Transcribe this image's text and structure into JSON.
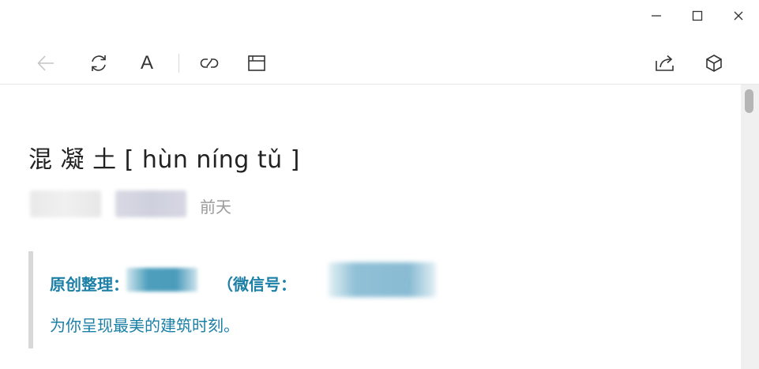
{
  "window": {
    "minimize": "minimize-icon",
    "maximize": "maximize-icon",
    "close": "close-icon"
  },
  "toolbar": {
    "left": [
      "back-arrow-icon",
      "refresh-icon",
      "text-size-icon",
      "link-icon",
      "window-icon"
    ],
    "right": [
      "share-icon",
      "cube-icon"
    ],
    "text_size_glyph": "A"
  },
  "article": {
    "title": "混 凝 土 [ hùn níng tǔ ]",
    "date": "前天",
    "quote": {
      "line1_label": "原创整理：",
      "line1_paren": "（微信号：",
      "line1_close": "）",
      "line2": "为你呈现最美的建筑时刻。"
    }
  },
  "colors": {
    "accent": "#1b7fa6",
    "quote_border": "#d8d8d8",
    "meta_text": "#9a9a9a"
  }
}
